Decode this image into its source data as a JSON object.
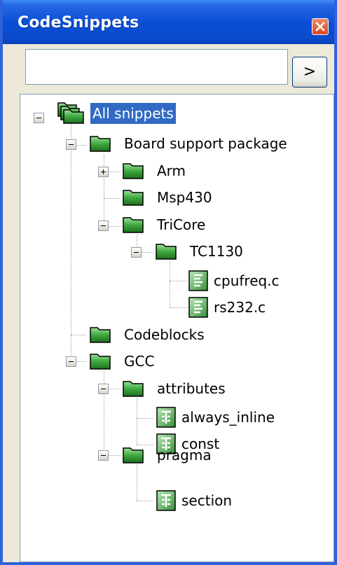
{
  "window": {
    "title": "CodeSnippets"
  },
  "search": {
    "value": "",
    "placeholder": "",
    "go_label": ">"
  },
  "tree": {
    "selected": "All snippets",
    "nodes": [
      {
        "label": "All snippets",
        "type": "root",
        "state": "expanded"
      },
      {
        "label": "Board support package",
        "type": "folder",
        "state": "expanded"
      },
      {
        "label": "Arm",
        "type": "folder",
        "state": "collapsed"
      },
      {
        "label": "Msp430",
        "type": "folder",
        "state": "leaf"
      },
      {
        "label": "TriCore",
        "type": "folder",
        "state": "expanded"
      },
      {
        "label": "TC1130",
        "type": "folder",
        "state": "expanded"
      },
      {
        "label": "cpufreq.c",
        "type": "file-snippet",
        "state": "leaf"
      },
      {
        "label": "rs232.c",
        "type": "file-snippet",
        "state": "leaf"
      },
      {
        "label": "Codeblocks",
        "type": "folder",
        "state": "leaf"
      },
      {
        "label": "GCC",
        "type": "folder",
        "state": "expanded"
      },
      {
        "label": "attributes",
        "type": "folder",
        "state": "expanded"
      },
      {
        "label": "always_inline",
        "type": "text-snippet",
        "state": "leaf"
      },
      {
        "label": "const",
        "type": "text-snippet",
        "state": "leaf"
      },
      {
        "label": "pragma",
        "type": "folder",
        "state": "expanded"
      },
      {
        "label": "section",
        "type": "text-snippet",
        "state": "leaf"
      }
    ]
  },
  "icons": {
    "title_close": "close-icon",
    "folder": "folder-icon",
    "root": "folders-icon",
    "file_snippet": "file-snippet-icon",
    "text_snippet": "text-snippet-icon"
  },
  "colors": {
    "titlebar": "#0a4fd6",
    "window_border": "#2e63d9",
    "selection": "#316ac5",
    "folder_green": "#3c9a3c",
    "close_button": "#d8451f"
  }
}
